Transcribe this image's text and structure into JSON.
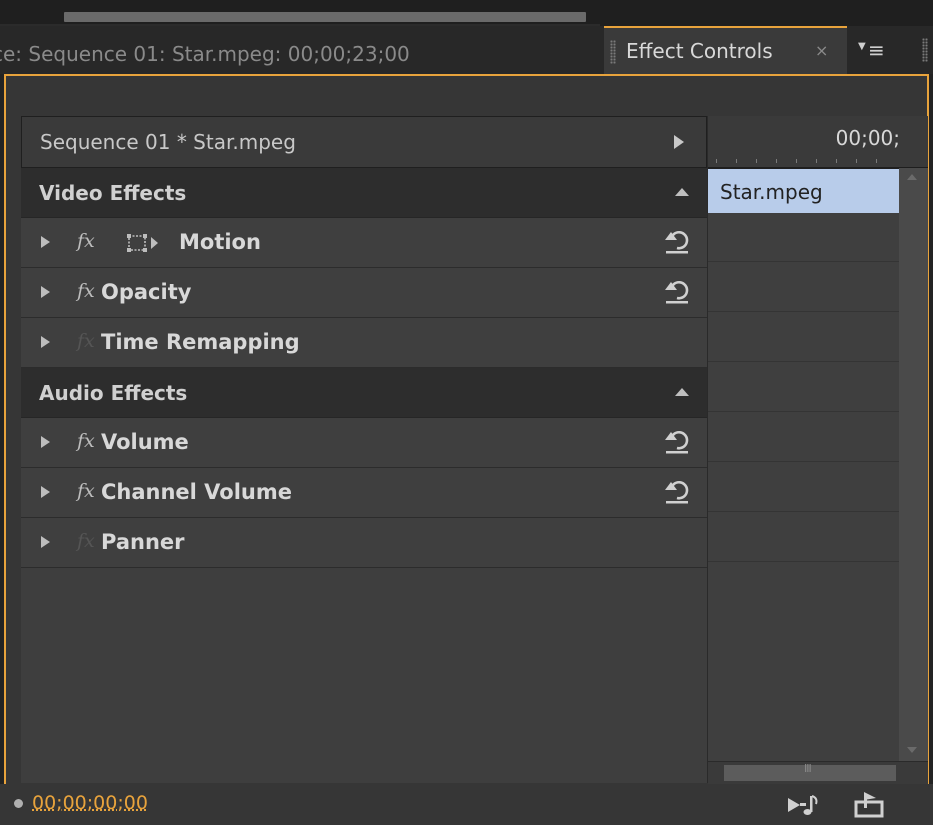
{
  "tabs": {
    "sequence_tab": "ce: Sequence 01: Star.mpeg: 00;00;23;00",
    "effect_controls": "Effect Controls",
    "close_glyph": "×",
    "menu_glyph": "≡"
  },
  "header": {
    "sequence_title": "Sequence 01 * Star.mpeg",
    "timecode": "00;00;"
  },
  "sections": {
    "video": "Video Effects",
    "audio": "Audio Effects"
  },
  "effects": {
    "motion": "Motion",
    "opacity": "Opacity",
    "time_remapping": "Time Remapping",
    "volume": "Volume",
    "channel_volume": "Channel Volume",
    "panner": "Panner"
  },
  "fx_glyph": "fx",
  "timeline": {
    "clip_name": "Star.mpeg",
    "scroll_grip": "III"
  },
  "footer": {
    "current_time": "00;00;00;00"
  },
  "colors": {
    "accent": "#e8a33c",
    "clip": "#b8ccea",
    "panel": "#363636"
  },
  "icons": [
    "motion-transform-icon",
    "reset-icon",
    "expand-triangle-icon",
    "collapse-triangle-icon",
    "play-audio-icon",
    "export-icon",
    "panel-menu-icon"
  ]
}
